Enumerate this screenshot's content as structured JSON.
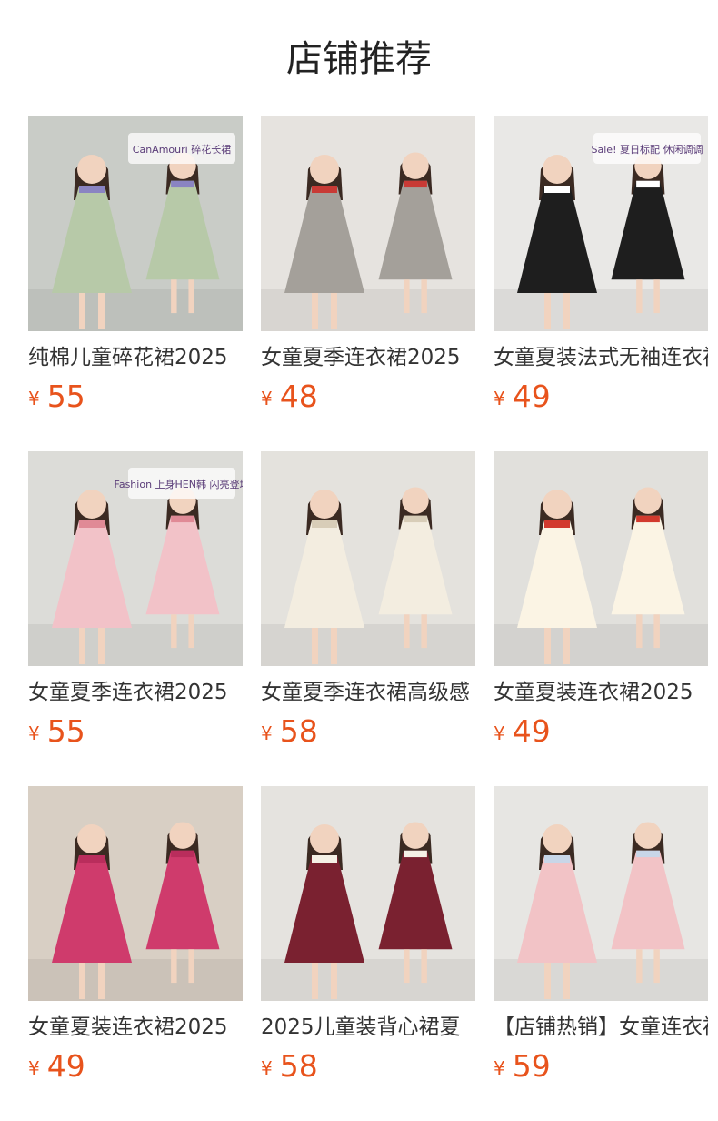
{
  "header": {
    "title": "店铺推荐"
  },
  "currency_symbol": "¥",
  "products": [
    {
      "name": "纯棉儿童碎花裙2025",
      "price": "55",
      "overlay_text": "CanAmouri 碎花长裙",
      "colors": {
        "bg": "#c9ccc7",
        "dress": "#b7c9a8",
        "accent": "#8a84c2"
      }
    },
    {
      "name": "女童夏季连衣裙2025",
      "price": "48",
      "overlay_text": "",
      "colors": {
        "bg": "#e6e3df",
        "dress": "#a4a09a",
        "accent": "#c83a35"
      }
    },
    {
      "name": "女童夏装法式无袖连衣裙",
      "price": "49",
      "overlay_text": "Sale! 夏日标配 休闲调调",
      "colors": {
        "bg": "#e9e8e6",
        "dress": "#1e1e1e",
        "accent": "#ffffff"
      }
    },
    {
      "name": "女童夏季连衣裙2025",
      "price": "55",
      "overlay_text": "Fashion 上身HEN韩 闪亮登场",
      "colors": {
        "bg": "#dcdcd8",
        "dress": "#f2c2c8",
        "accent": "#e08a96"
      }
    },
    {
      "name": "女童夏季连衣裙高级感",
      "price": "58",
      "overlay_text": "",
      "colors": {
        "bg": "#e4e2dd",
        "dress": "#f3ede0",
        "accent": "#d8cdb8"
      }
    },
    {
      "name": "女童夏装连衣裙2025",
      "price": "49",
      "overlay_text": "",
      "colors": {
        "bg": "#e1e0dc",
        "dress": "#fbf4e4",
        "accent": "#d23a2e"
      }
    },
    {
      "name": "女童夏装连衣裙2025",
      "price": "49",
      "overlay_text": "",
      "colors": {
        "bg": "#d8cfc4",
        "dress": "#cf3b6c",
        "accent": "#b92d5c"
      }
    },
    {
      "name": "2025儿童装背心裙夏",
      "price": "58",
      "overlay_text": "",
      "colors": {
        "bg": "#e5e3df",
        "dress": "#7a2130",
        "accent": "#f5f1e6"
      }
    },
    {
      "name": "【店铺热销】女童连衣裙",
      "price": "59",
      "overlay_text": "",
      "colors": {
        "bg": "#e7e6e3",
        "dress": "#f2c3c6",
        "accent": "#c8d6e8"
      }
    }
  ]
}
